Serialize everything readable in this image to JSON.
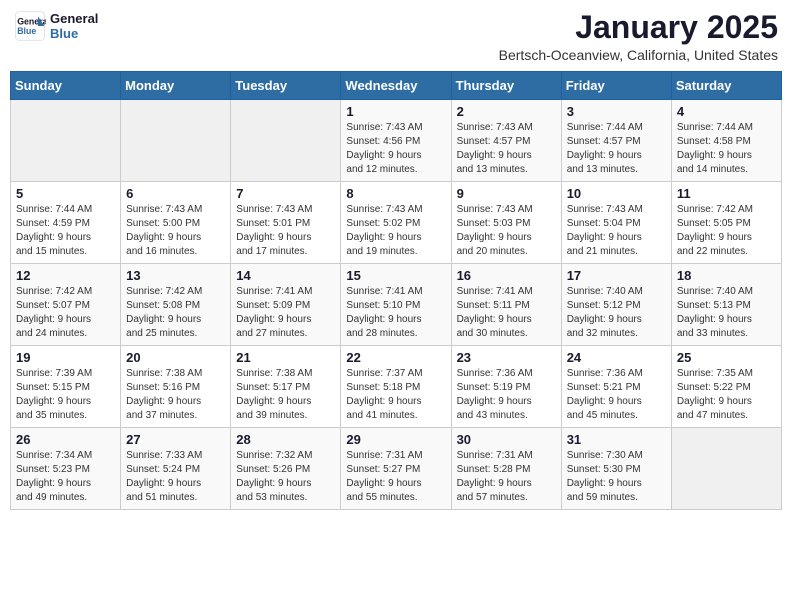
{
  "logo": {
    "line1": "General",
    "line2": "Blue"
  },
  "title": "January 2025",
  "location": "Bertsch-Oceanview, California, United States",
  "days_of_week": [
    "Sunday",
    "Monday",
    "Tuesday",
    "Wednesday",
    "Thursday",
    "Friday",
    "Saturday"
  ],
  "weeks": [
    [
      {
        "day": "",
        "info": ""
      },
      {
        "day": "",
        "info": ""
      },
      {
        "day": "",
        "info": ""
      },
      {
        "day": "1",
        "info": "Sunrise: 7:43 AM\nSunset: 4:56 PM\nDaylight: 9 hours\nand 12 minutes."
      },
      {
        "day": "2",
        "info": "Sunrise: 7:43 AM\nSunset: 4:57 PM\nDaylight: 9 hours\nand 13 minutes."
      },
      {
        "day": "3",
        "info": "Sunrise: 7:44 AM\nSunset: 4:57 PM\nDaylight: 9 hours\nand 13 minutes."
      },
      {
        "day": "4",
        "info": "Sunrise: 7:44 AM\nSunset: 4:58 PM\nDaylight: 9 hours\nand 14 minutes."
      }
    ],
    [
      {
        "day": "5",
        "info": "Sunrise: 7:44 AM\nSunset: 4:59 PM\nDaylight: 9 hours\nand 15 minutes."
      },
      {
        "day": "6",
        "info": "Sunrise: 7:43 AM\nSunset: 5:00 PM\nDaylight: 9 hours\nand 16 minutes."
      },
      {
        "day": "7",
        "info": "Sunrise: 7:43 AM\nSunset: 5:01 PM\nDaylight: 9 hours\nand 17 minutes."
      },
      {
        "day": "8",
        "info": "Sunrise: 7:43 AM\nSunset: 5:02 PM\nDaylight: 9 hours\nand 19 minutes."
      },
      {
        "day": "9",
        "info": "Sunrise: 7:43 AM\nSunset: 5:03 PM\nDaylight: 9 hours\nand 20 minutes."
      },
      {
        "day": "10",
        "info": "Sunrise: 7:43 AM\nSunset: 5:04 PM\nDaylight: 9 hours\nand 21 minutes."
      },
      {
        "day": "11",
        "info": "Sunrise: 7:42 AM\nSunset: 5:05 PM\nDaylight: 9 hours\nand 22 minutes."
      }
    ],
    [
      {
        "day": "12",
        "info": "Sunrise: 7:42 AM\nSunset: 5:07 PM\nDaylight: 9 hours\nand 24 minutes."
      },
      {
        "day": "13",
        "info": "Sunrise: 7:42 AM\nSunset: 5:08 PM\nDaylight: 9 hours\nand 25 minutes."
      },
      {
        "day": "14",
        "info": "Sunrise: 7:41 AM\nSunset: 5:09 PM\nDaylight: 9 hours\nand 27 minutes."
      },
      {
        "day": "15",
        "info": "Sunrise: 7:41 AM\nSunset: 5:10 PM\nDaylight: 9 hours\nand 28 minutes."
      },
      {
        "day": "16",
        "info": "Sunrise: 7:41 AM\nSunset: 5:11 PM\nDaylight: 9 hours\nand 30 minutes."
      },
      {
        "day": "17",
        "info": "Sunrise: 7:40 AM\nSunset: 5:12 PM\nDaylight: 9 hours\nand 32 minutes."
      },
      {
        "day": "18",
        "info": "Sunrise: 7:40 AM\nSunset: 5:13 PM\nDaylight: 9 hours\nand 33 minutes."
      }
    ],
    [
      {
        "day": "19",
        "info": "Sunrise: 7:39 AM\nSunset: 5:15 PM\nDaylight: 9 hours\nand 35 minutes."
      },
      {
        "day": "20",
        "info": "Sunrise: 7:38 AM\nSunset: 5:16 PM\nDaylight: 9 hours\nand 37 minutes."
      },
      {
        "day": "21",
        "info": "Sunrise: 7:38 AM\nSunset: 5:17 PM\nDaylight: 9 hours\nand 39 minutes."
      },
      {
        "day": "22",
        "info": "Sunrise: 7:37 AM\nSunset: 5:18 PM\nDaylight: 9 hours\nand 41 minutes."
      },
      {
        "day": "23",
        "info": "Sunrise: 7:36 AM\nSunset: 5:19 PM\nDaylight: 9 hours\nand 43 minutes."
      },
      {
        "day": "24",
        "info": "Sunrise: 7:36 AM\nSunset: 5:21 PM\nDaylight: 9 hours\nand 45 minutes."
      },
      {
        "day": "25",
        "info": "Sunrise: 7:35 AM\nSunset: 5:22 PM\nDaylight: 9 hours\nand 47 minutes."
      }
    ],
    [
      {
        "day": "26",
        "info": "Sunrise: 7:34 AM\nSunset: 5:23 PM\nDaylight: 9 hours\nand 49 minutes."
      },
      {
        "day": "27",
        "info": "Sunrise: 7:33 AM\nSunset: 5:24 PM\nDaylight: 9 hours\nand 51 minutes."
      },
      {
        "day": "28",
        "info": "Sunrise: 7:32 AM\nSunset: 5:26 PM\nDaylight: 9 hours\nand 53 minutes."
      },
      {
        "day": "29",
        "info": "Sunrise: 7:31 AM\nSunset: 5:27 PM\nDaylight: 9 hours\nand 55 minutes."
      },
      {
        "day": "30",
        "info": "Sunrise: 7:31 AM\nSunset: 5:28 PM\nDaylight: 9 hours\nand 57 minutes."
      },
      {
        "day": "31",
        "info": "Sunrise: 7:30 AM\nSunset: 5:30 PM\nDaylight: 9 hours\nand 59 minutes."
      },
      {
        "day": "",
        "info": ""
      }
    ]
  ]
}
